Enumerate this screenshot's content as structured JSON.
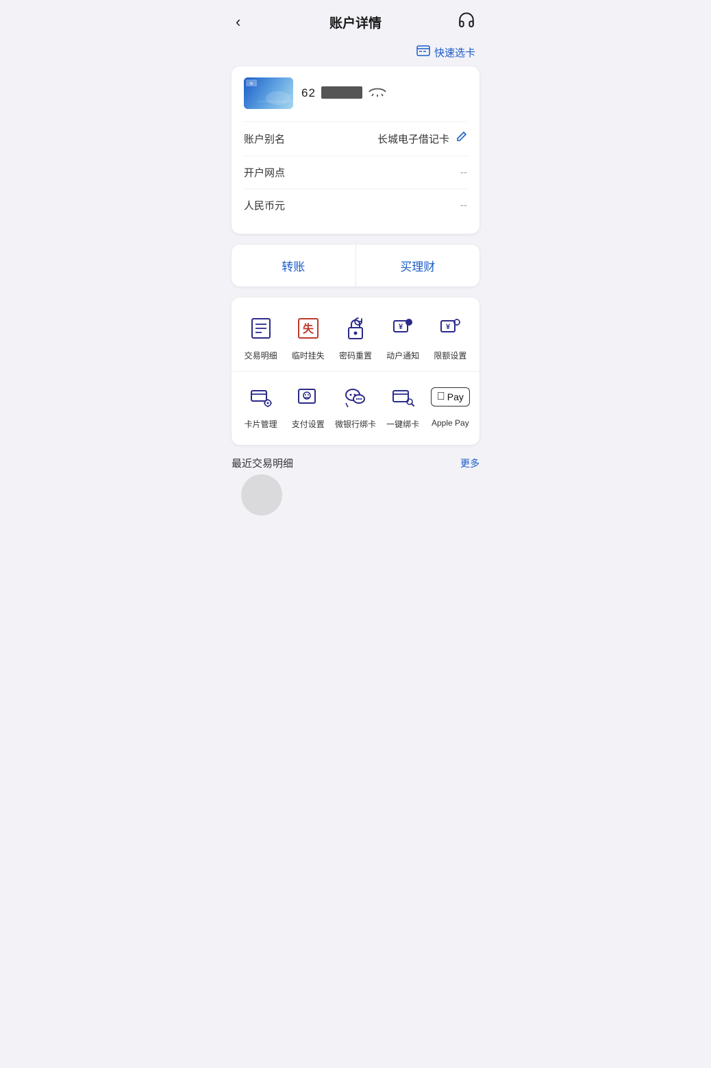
{
  "header": {
    "back_label": "‹",
    "title": "账户详情",
    "support_icon": "headphones"
  },
  "quick_select": {
    "icon": "⊟",
    "label": "快速选卡"
  },
  "card": {
    "number_prefix": "62",
    "number_redacted": true,
    "alias_label": "账户别名",
    "alias_value": "长城电子借记卡",
    "branch_label": "开户网点",
    "branch_value": "--",
    "currency_label": "人民币元",
    "currency_value": "--"
  },
  "actions": [
    {
      "label": "转账",
      "id": "transfer"
    },
    {
      "label": "买理财",
      "id": "invest"
    }
  ],
  "icon_grid": {
    "row1": [
      {
        "id": "transaction-detail",
        "label": "交易明细",
        "icon": "list"
      },
      {
        "id": "temp-freeze",
        "label": "临时挂失",
        "icon": "freeze"
      },
      {
        "id": "password-reset",
        "label": "密码重置",
        "icon": "lock-reset"
      },
      {
        "id": "activity-notify",
        "label": "动户通知",
        "icon": "notify"
      },
      {
        "id": "limit-setting",
        "label": "限额设置",
        "icon": "limit"
      }
    ],
    "row2": [
      {
        "id": "card-manage",
        "label": "卡片管理",
        "icon": "card-manage"
      },
      {
        "id": "payment-setting",
        "label": "支付设置",
        "icon": "payment"
      },
      {
        "id": "webank-bind",
        "label": "微银行绑卡",
        "icon": "wechat"
      },
      {
        "id": "one-click-bind",
        "label": "一键绑卡",
        "icon": "one-click"
      },
      {
        "id": "apple-pay",
        "label": "Apple Pay",
        "icon": "apple-pay"
      }
    ]
  },
  "recent": {
    "title": "最近交易明细",
    "more_label": "更多"
  }
}
